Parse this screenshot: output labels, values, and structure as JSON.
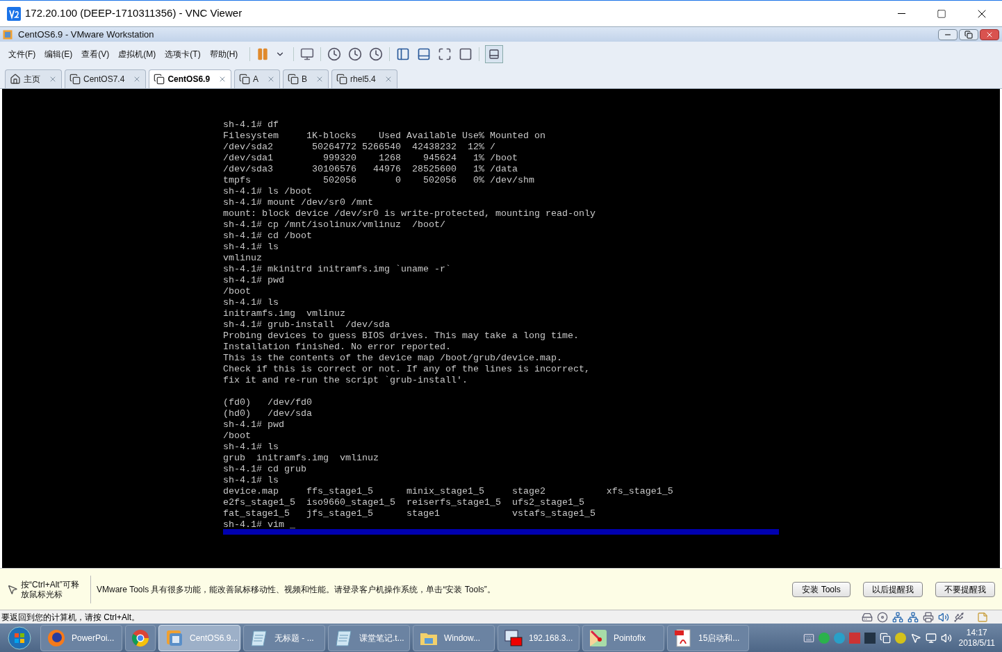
{
  "window": {
    "title": "172.20.100 (DEEP-1710311356) - VNC Viewer"
  },
  "vmware": {
    "title": "CentOS6.9 - VMware Workstation",
    "menu": [
      "文件(F)",
      "编辑(E)",
      "查看(V)",
      "虚拟机(M)",
      "选项卡(T)",
      "帮助(H)"
    ],
    "tabs": [
      {
        "label": "主页",
        "kind": "home",
        "selected": false
      },
      {
        "label": "CentOS7.4",
        "kind": "vm",
        "selected": false
      },
      {
        "label": "CentOS6.9",
        "kind": "vm",
        "selected": true
      },
      {
        "label": "A",
        "kind": "vm",
        "selected": false
      },
      {
        "label": "B",
        "kind": "vm",
        "selected": false
      },
      {
        "label": "rhel5.4",
        "kind": "vm",
        "selected": false
      }
    ]
  },
  "terminal": {
    "blocks": [
      [
        "sh-4.1# df",
        "Filesystem     1K-blocks    Used Available Use% Mounted on",
        "/dev/sda2       50264772 5266540  42438232  12% /",
        "/dev/sda1         999320    1268    945624   1% /boot",
        "/dev/sda3       30106576   44976  28525600   1% /data",
        "tmpfs             502056       0    502056   0% /dev/shm",
        "sh-4.1# ls /boot",
        "sh-4.1# mount /dev/sr0 /mnt",
        "mount: block device /dev/sr0 is write-protected, mounting read-only",
        "sh-4.1# cp /mnt/isolinux/vmlinuz  /boot/",
        "sh-4.1# cd /boot",
        "sh-4.1# ls",
        "vmlinuz",
        "sh-4.1# mkinitrd initramfs.img `uname -r`",
        "sh-4.1# pwd",
        "/boot",
        "sh-4.1# ls",
        "initramfs.img  vmlinuz",
        "sh-4.1# grub-install  /dev/sda",
        "Probing devices to guess BIOS drives. This may take a long time.",
        "Installation finished. No error reported.",
        "This is the contents of the device map /boot/grub/device.map.",
        "Check if this is correct or not. If any of the lines is incorrect,",
        "fix it and re-run the script `grub-install'."
      ],
      [
        "(fd0)   /dev/fd0",
        "(hd0)   /dev/sda",
        "sh-4.1# pwd",
        "/boot",
        "sh-4.1# ls",
        "grub  initramfs.img  vmlinuz",
        "sh-4.1# cd grub",
        "sh-4.1# ls",
        "device.map     ffs_stage1_5      minix_stage1_5     stage2           xfs_stage1_5",
        "e2fs_stage1_5  iso9660_stage1_5  reiserfs_stage1_5  ufs2_stage1_5",
        "fat_stage1_5   jfs_stage1_5      stage1             vstafs_stage1_5",
        "sh-4.1# vim _"
      ]
    ]
  },
  "notice": {
    "hint": "按“Ctrl+Alt”可释放鼠标光标",
    "message": "VMware Tools 具有很多功能，能改善鼠标移动性、视频和性能。请登录客户机操作系统，单击“安装 Tools”。",
    "buttons": [
      "安装 Tools",
      "以后提醒我",
      "不要提醒我"
    ]
  },
  "status_text": "要返回到您的计算机，请按 Ctrl+Alt。",
  "taskbar": {
    "items": [
      {
        "label": "PowerPoi...",
        "selected": false
      },
      {
        "selected": false
      },
      {
        "label": "CentOS6.9...",
        "selected": true
      },
      {
        "label": "无标题 - ...",
        "selected": false
      },
      {
        "label": "课堂笔记.t...",
        "selected": false
      },
      {
        "label": "Window...",
        "selected": false
      },
      {
        "label": "192.168.3...",
        "selected": false
      },
      {
        "label": "Pointofix",
        "selected": false
      },
      {
        "label": "15启动和...",
        "selected": false
      }
    ],
    "time": "14:17",
    "date": "2018/5/11"
  }
}
